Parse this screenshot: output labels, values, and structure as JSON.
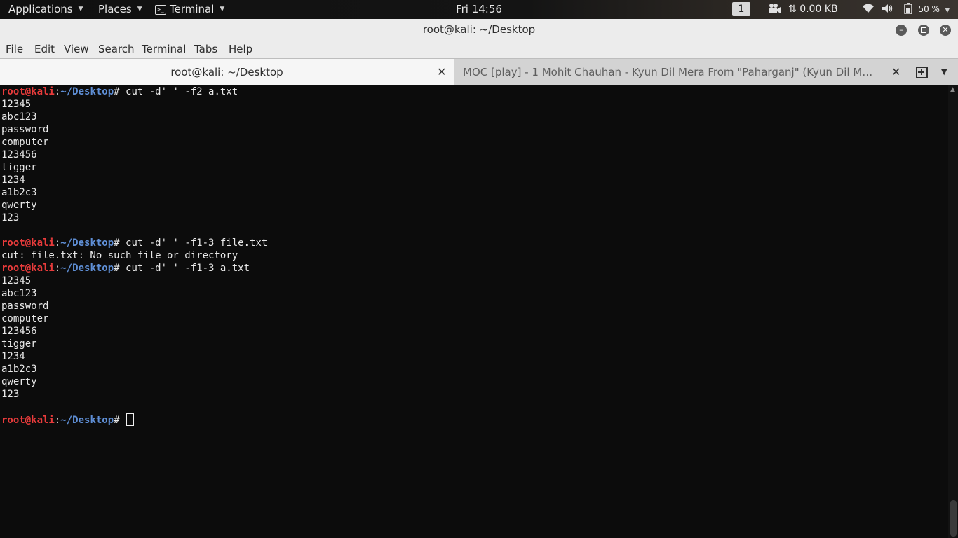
{
  "panel": {
    "applications": "Applications",
    "places": "Places",
    "terminal": "Terminal",
    "clock": "Fri 14:56",
    "workspace": "1",
    "network_speed": "0.00 KB",
    "battery": "50 %"
  },
  "window": {
    "title": "root@kali: ~/Desktop"
  },
  "menu": {
    "file": "File",
    "edit": "Edit",
    "view": "View",
    "search": "Search",
    "terminal": "Terminal",
    "tabs": "Tabs",
    "help": "Help"
  },
  "tabs": [
    {
      "label": "root@kali: ~/Desktop",
      "active": true
    },
    {
      "label": "MOC [play] - 1 Mohit Chauhan - Kyun Dil Mera From \"Paharganj\" (Kyun Dil Mera (From \"Paharganj\")",
      "active": false
    }
  ],
  "prompt": {
    "user": "root@kali",
    "sep": ":",
    "path": "~/Desktop",
    "symbol": "# "
  },
  "terminal_lines": [
    {
      "type": "cmd",
      "text": "cut -d' ' -f2 a.txt"
    },
    {
      "type": "out",
      "text": "12345"
    },
    {
      "type": "out",
      "text": "abc123"
    },
    {
      "type": "out",
      "text": "password"
    },
    {
      "type": "out",
      "text": "computer"
    },
    {
      "type": "out",
      "text": "123456"
    },
    {
      "type": "out",
      "text": "tigger"
    },
    {
      "type": "out",
      "text": "1234"
    },
    {
      "type": "out",
      "text": "a1b2c3"
    },
    {
      "type": "out",
      "text": "qwerty"
    },
    {
      "type": "out",
      "text": "123"
    },
    {
      "type": "out",
      "text": ""
    },
    {
      "type": "cmd",
      "text": "cut -d' ' -f1-3 file.txt"
    },
    {
      "type": "out",
      "text": "cut: file.txt: No such file or directory"
    },
    {
      "type": "cmd",
      "text": "cut -d' ' -f1-3 a.txt"
    },
    {
      "type": "out",
      "text": "12345"
    },
    {
      "type": "out",
      "text": "abc123"
    },
    {
      "type": "out",
      "text": "password"
    },
    {
      "type": "out",
      "text": "computer"
    },
    {
      "type": "out",
      "text": "123456"
    },
    {
      "type": "out",
      "text": "tigger"
    },
    {
      "type": "out",
      "text": "1234"
    },
    {
      "type": "out",
      "text": "a1b2c3"
    },
    {
      "type": "out",
      "text": "qwerty"
    },
    {
      "type": "out",
      "text": "123"
    },
    {
      "type": "out",
      "text": ""
    },
    {
      "type": "cursor",
      "text": ""
    }
  ],
  "colors": {
    "prompt_user": "#e83b3b",
    "prompt_path": "#5f8fd6",
    "terminal_bg": "#0c0c0c",
    "terminal_fg": "#e8e8e8"
  }
}
